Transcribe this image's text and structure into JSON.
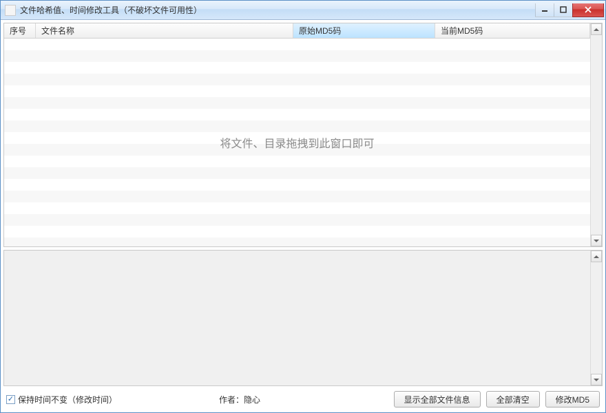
{
  "window": {
    "title": "文件哈希值、时间修改工具（不破坏文件可用性）"
  },
  "table": {
    "columns": {
      "seq": "序号",
      "name": "文件名称",
      "original_md5": "原始MD5码",
      "current_md5": "当前MD5码"
    },
    "rows": [],
    "empty_hint": "将文件、目录拖拽到此窗口即可"
  },
  "output": {
    "text": ""
  },
  "footer": {
    "keep_time_checkbox": {
      "label": "保持时间不变（修改时间）",
      "checked": true
    },
    "author_label": "作者：隐心",
    "buttons": {
      "show_all_info": "显示全部文件信息",
      "clear_all": "全部清空",
      "modify_md5": "修改MD5"
    }
  }
}
